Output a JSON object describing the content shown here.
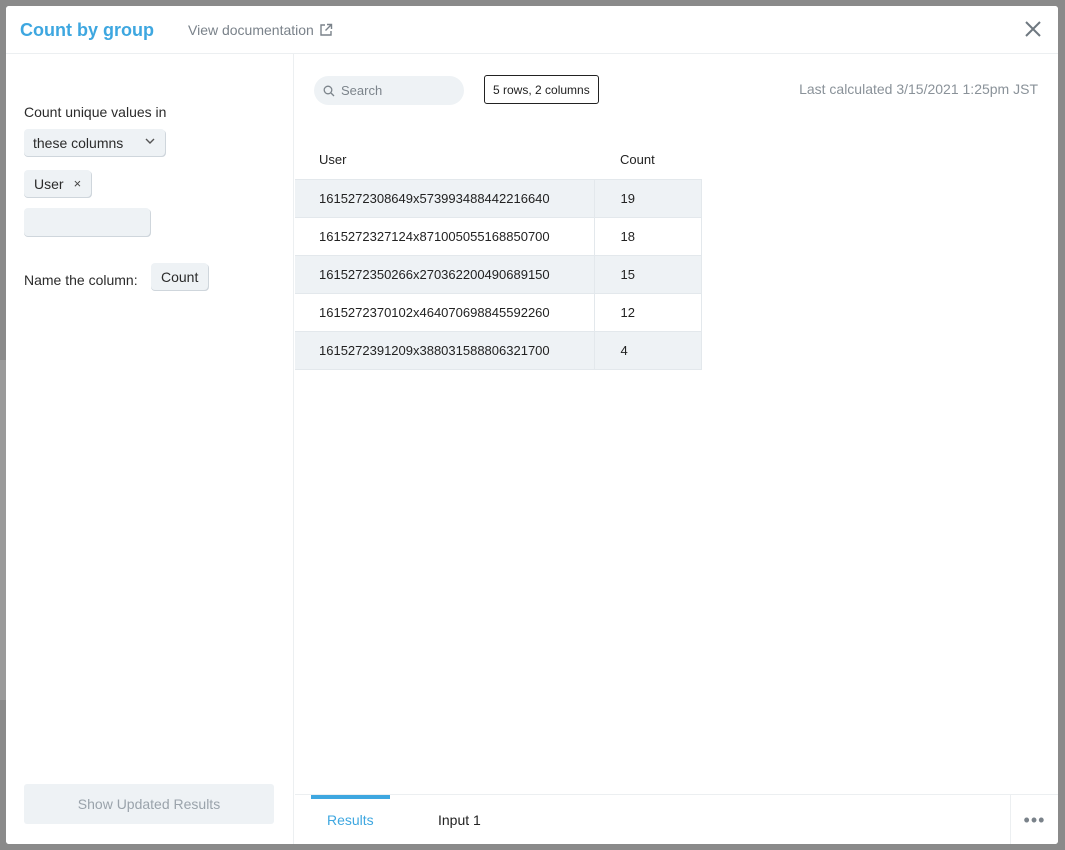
{
  "modal": {
    "title": "Count by group",
    "doc_link": "View documentation"
  },
  "config": {
    "count_label": "Count unique values in",
    "column_mode": "these columns",
    "selected_columns": [
      "User"
    ],
    "name_label": "Name the column:",
    "name_value": "Count",
    "show_button": "Show Updated Results"
  },
  "results": {
    "search_placeholder": "Search",
    "rows_badge": "5 rows, 2 columns",
    "last_calculated": "Last calculated 3/15/2021 1:25pm JST",
    "columns": [
      "User",
      "Count"
    ],
    "rows": [
      [
        "1615272308649x573993488442216640",
        "19"
      ],
      [
        "1615272327124x871005055168850700",
        "18"
      ],
      [
        "1615272350266x270362200490689150",
        "15"
      ],
      [
        "1615272370102x464070698845592260",
        "12"
      ],
      [
        "1615272391209x388031588806321700",
        "4"
      ]
    ]
  },
  "tabs": [
    "Results",
    "Input 1"
  ],
  "colors": {
    "accent": "#3ea7e0",
    "stripe": "#eef2f5"
  }
}
